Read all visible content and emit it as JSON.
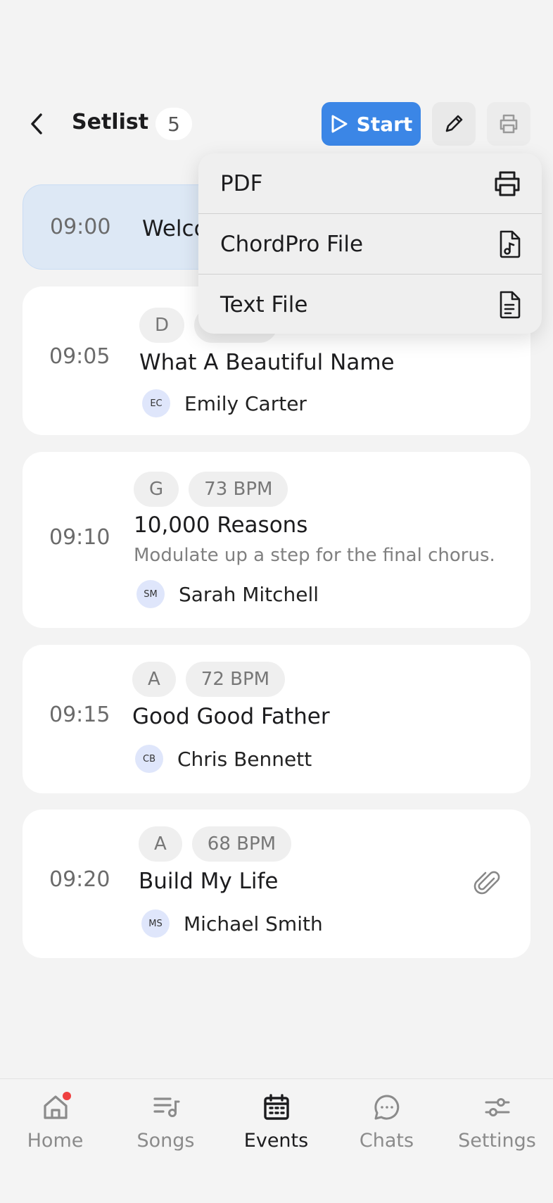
{
  "header": {
    "title": "Setlist",
    "count": "5",
    "start_label": "Start"
  },
  "menu": {
    "items": [
      {
        "label": "PDF",
        "icon": "printer-icon"
      },
      {
        "label": "ChordPro File",
        "icon": "music-file-icon"
      },
      {
        "label": "Text File",
        "icon": "text-file-icon"
      }
    ]
  },
  "setlist": [
    {
      "time": "09:00",
      "title": "Welco",
      "current": true
    },
    {
      "time": "09:05",
      "key": "D",
      "bpm": "",
      "title": "What A Beautiful Name",
      "person": {
        "initials": "EC",
        "name": "Emily Carter"
      }
    },
    {
      "time": "09:10",
      "key": "G",
      "bpm": "73 BPM",
      "title": "10,000 Reasons",
      "note": "Modulate up a step for the final chorus.",
      "person": {
        "initials": "SM",
        "name": "Sarah Mitchell"
      }
    },
    {
      "time": "09:15",
      "key": "A",
      "bpm": "72 BPM",
      "title": "Good Good Father",
      "person": {
        "initials": "CB",
        "name": "Chris Bennett"
      }
    },
    {
      "time": "09:20",
      "key": "A",
      "bpm": "68 BPM",
      "title": "Build My Life",
      "person": {
        "initials": "MS",
        "name": "Michael Smith"
      },
      "attachment": true
    }
  ],
  "tabs": [
    {
      "label": "Home",
      "icon": "home-icon",
      "badge": true
    },
    {
      "label": "Songs",
      "icon": "songs-icon"
    },
    {
      "label": "Events",
      "icon": "calendar-icon",
      "active": true
    },
    {
      "label": "Chats",
      "icon": "chat-icon"
    },
    {
      "label": "Settings",
      "icon": "sliders-icon"
    }
  ],
  "colors": {
    "accent": "#3b86e6",
    "current_item_bg": "#dde8f5",
    "badge_dot": "#ef4040"
  }
}
